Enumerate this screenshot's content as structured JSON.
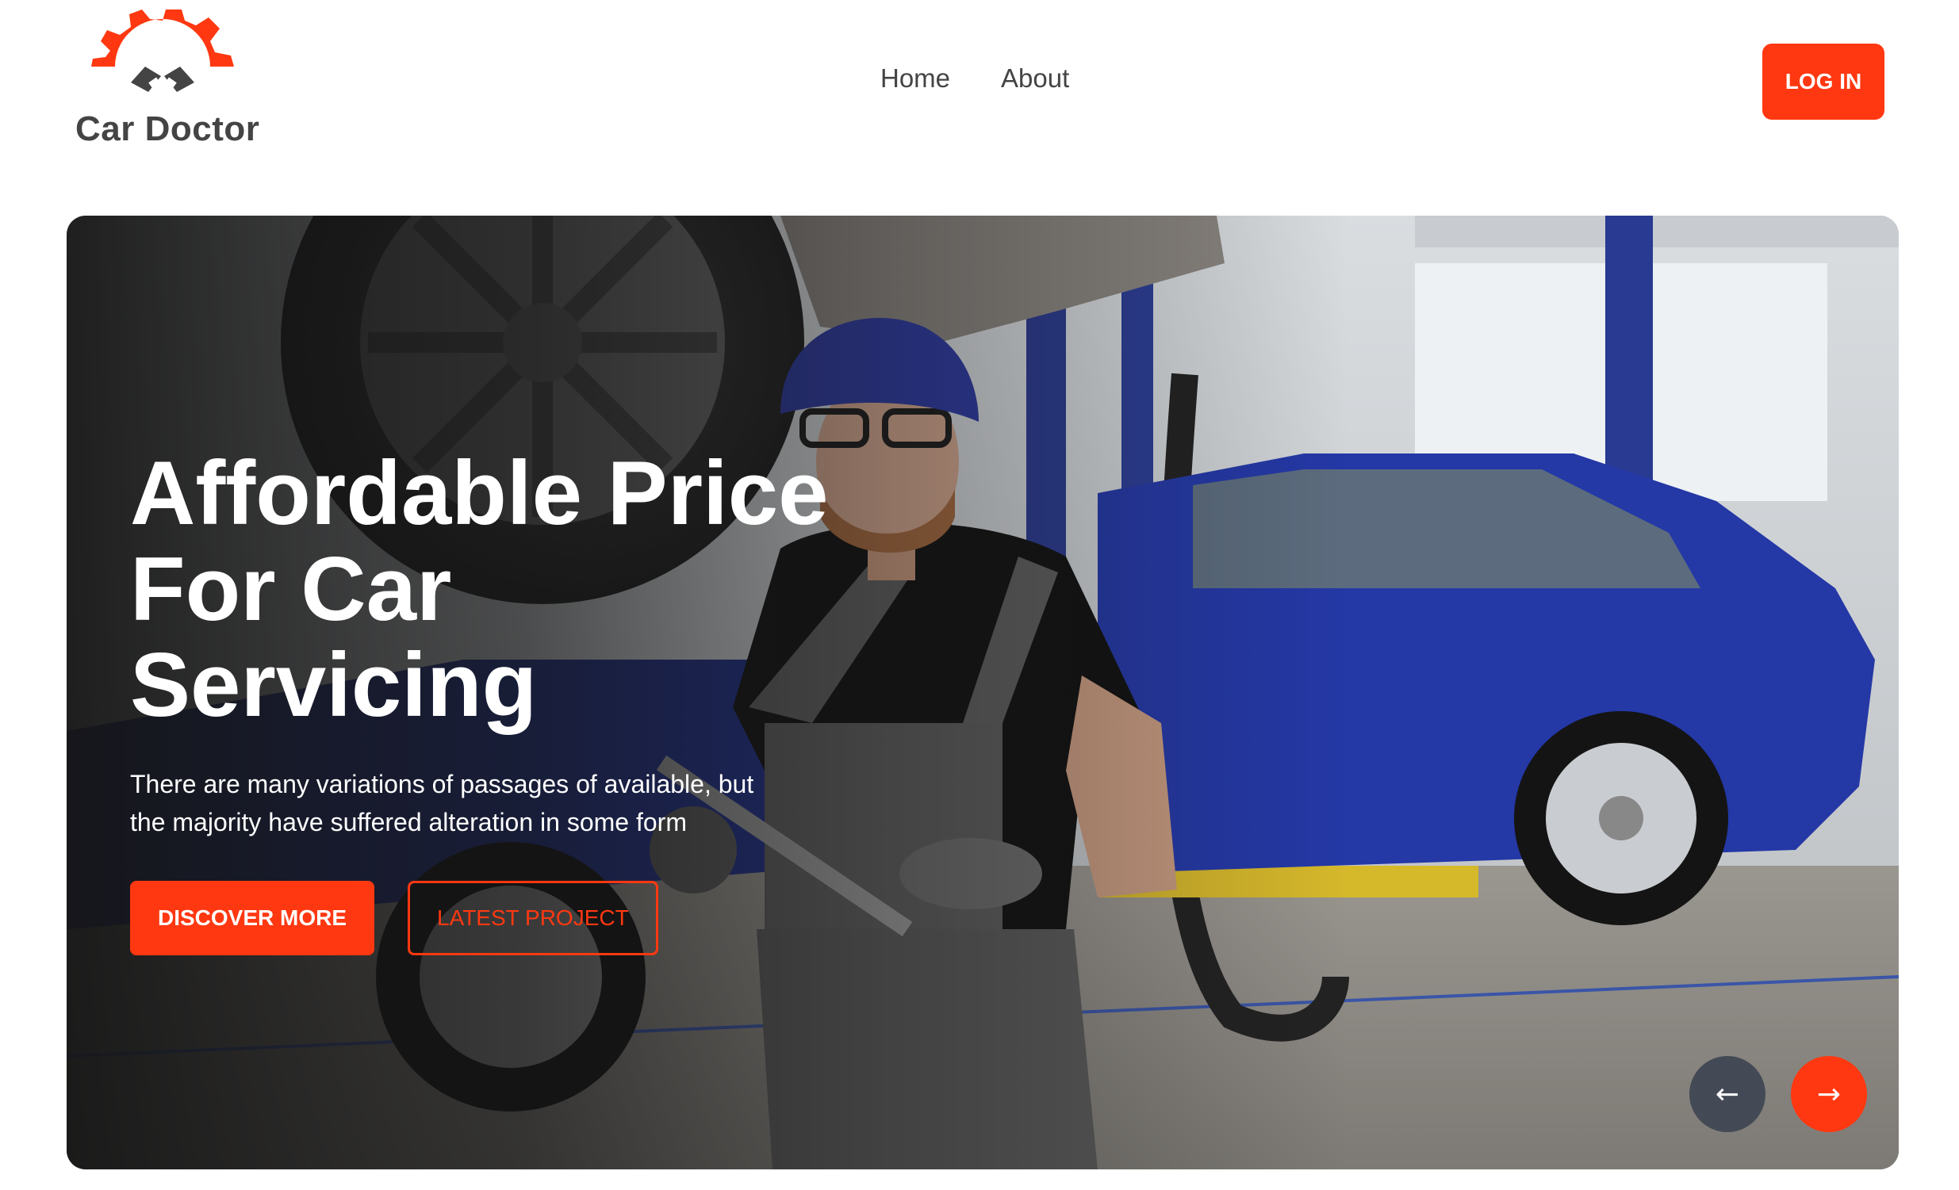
{
  "brand": {
    "name": "Car Doctor",
    "accent_color": "#FF3811",
    "logo_icon": "gear-with-pistons-icon"
  },
  "nav": {
    "links": [
      {
        "label": "Home"
      },
      {
        "label": "About"
      }
    ],
    "login_label": "LOG IN"
  },
  "hero": {
    "title": "Affordable Price For Car Servicing",
    "description": "There are many variations of passages of available, but the majority have suffered alteration in some form",
    "primary_button": "DISCOVER MORE",
    "secondary_button": "LATEST PROJECT",
    "background": "photo of mechanic in blue cap and grey overalls in car workshop with blue SUV on lift",
    "prev_icon": "arrow-left-icon",
    "next_icon": "arrow-right-icon"
  }
}
